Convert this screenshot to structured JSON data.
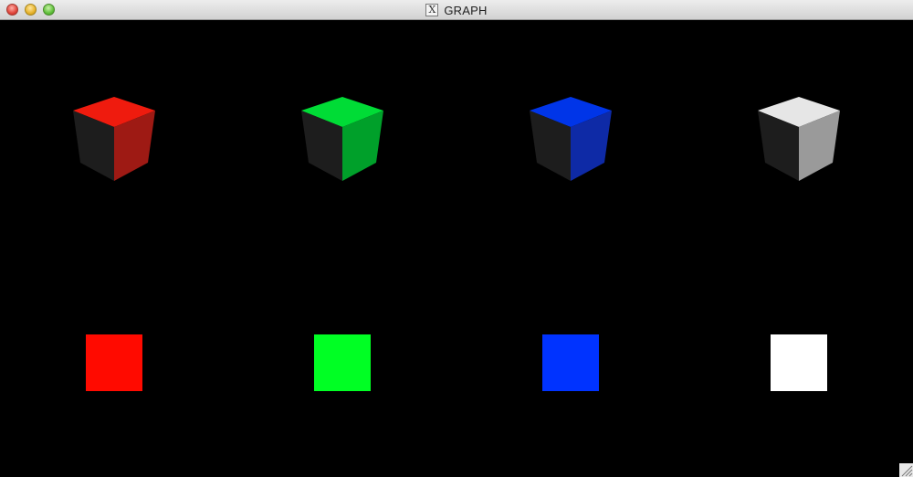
{
  "window": {
    "title": "GRAPH",
    "icon": "x11-icon"
  },
  "cubes": [
    {
      "name": "red",
      "top": "#ef1b0e",
      "left": "#1d1d1d",
      "right": "#9e1a14"
    },
    {
      "name": "green",
      "top": "#00dc36",
      "left": "#1d1d1d",
      "right": "#00a02a"
    },
    {
      "name": "blue",
      "top": "#0035e8",
      "left": "#1d1d1d",
      "right": "#0e2aa6"
    },
    {
      "name": "white",
      "top": "#e6e6e6",
      "left": "#1d1d1d",
      "right": "#9a9a9a"
    }
  ],
  "squares": [
    {
      "name": "red",
      "color": "#ff0a00"
    },
    {
      "name": "green",
      "color": "#00ff24"
    },
    {
      "name": "blue",
      "color": "#0033ff"
    },
    {
      "name": "white",
      "color": "#ffffff"
    }
  ],
  "colors": {
    "background": "#000000"
  }
}
